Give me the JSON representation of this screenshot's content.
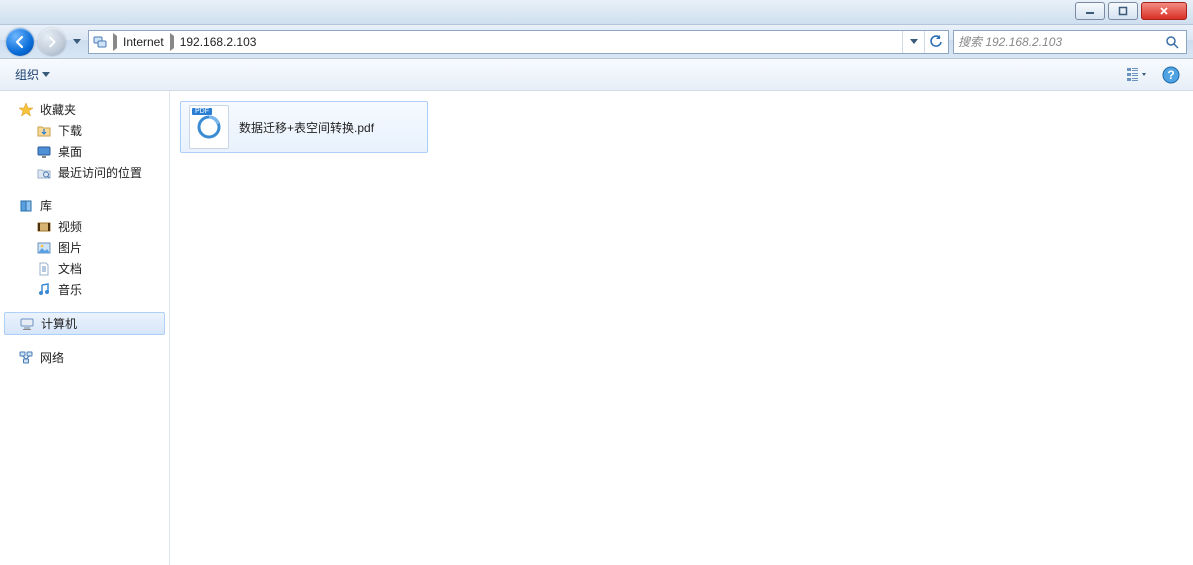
{
  "titlebar": {},
  "nav": {
    "breadcrumb": [
      {
        "label": "Internet"
      },
      {
        "label": "192.168.2.103"
      }
    ]
  },
  "search": {
    "placeholder": "搜索 192.168.2.103"
  },
  "toolbar": {
    "organize": "组织"
  },
  "sidebar": {
    "groups": [
      {
        "head": "收藏夹",
        "icon": "star",
        "items": [
          {
            "label": "下载",
            "icon": "folder-down"
          },
          {
            "label": "桌面",
            "icon": "desktop"
          },
          {
            "label": "最近访问的位置",
            "icon": "recent"
          }
        ]
      },
      {
        "head": "库",
        "icon": "libraries",
        "items": [
          {
            "label": "视频",
            "icon": "video"
          },
          {
            "label": "图片",
            "icon": "picture"
          },
          {
            "label": "文档",
            "icon": "doc"
          },
          {
            "label": "音乐",
            "icon": "music"
          }
        ]
      },
      {
        "head": "计算机",
        "icon": "computer",
        "selected": true,
        "items": []
      },
      {
        "head": "网络",
        "icon": "network",
        "items": []
      }
    ]
  },
  "content": {
    "files": [
      {
        "name": "数据迁移+表空间转换.pdf",
        "type": "pdf",
        "badge": "PDF"
      }
    ]
  }
}
